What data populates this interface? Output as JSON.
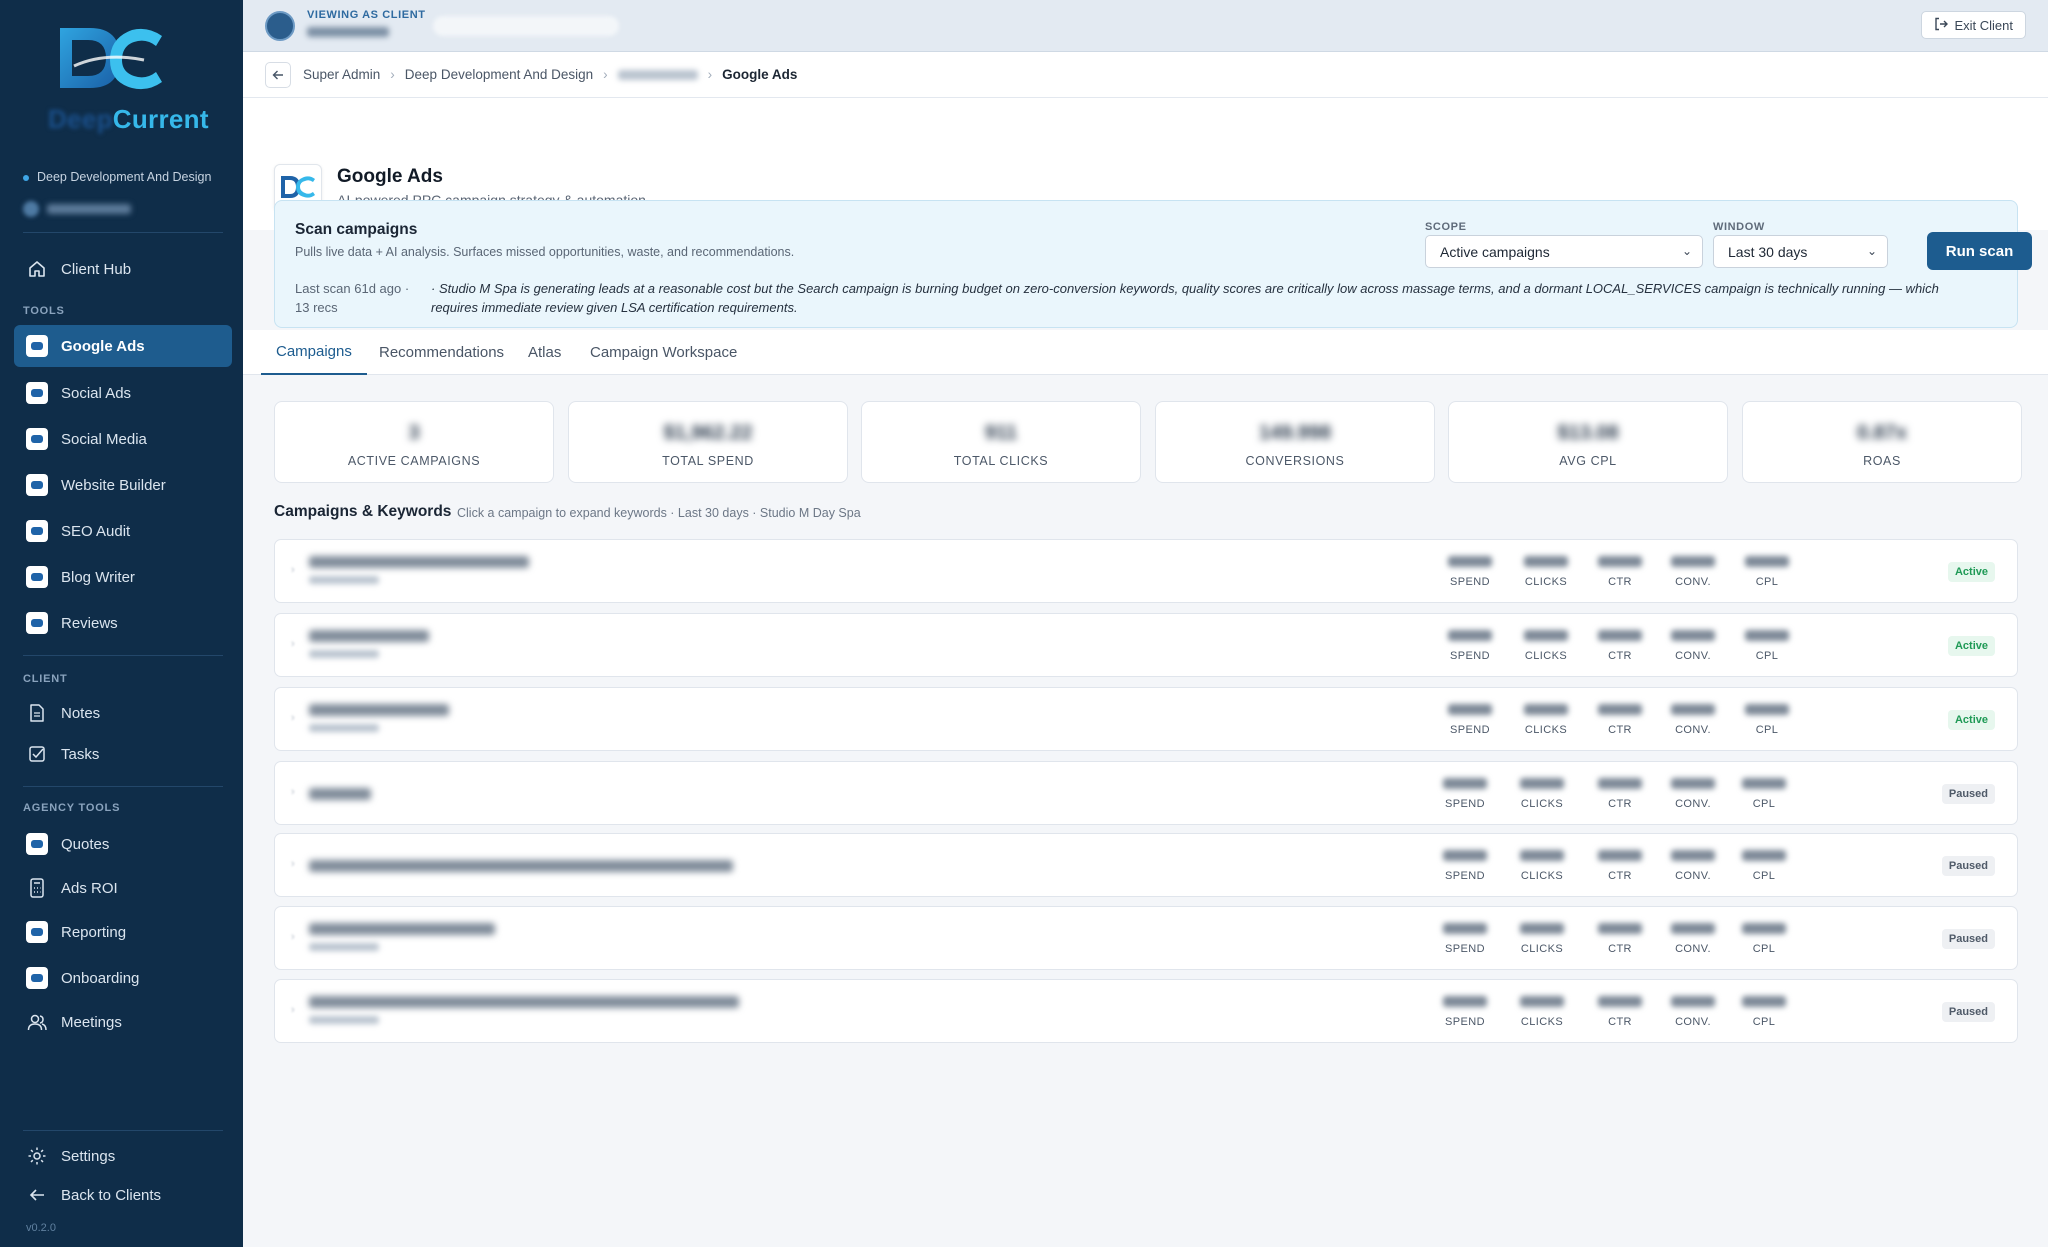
{
  "brand": {
    "name_part1": "Deep",
    "name_part2": "Current"
  },
  "sidebar": {
    "client_context": "Deep Development And Design",
    "sections": {
      "tools": "TOOLS",
      "client": "CLIENT",
      "agency": "AGENCY TOOLS"
    },
    "hub": "Client Hub",
    "tools": [
      "Google Ads",
      "Social Ads",
      "Social Media",
      "Website Builder",
      "SEO Audit",
      "Blog Writer",
      "Reviews"
    ],
    "client_items": [
      "Notes",
      "Tasks"
    ],
    "agency_items": [
      "Quotes",
      "Ads ROI",
      "Reporting",
      "Onboarding",
      "Meetings"
    ],
    "settings": "Settings",
    "back": "Back to Clients",
    "version": "v0.2.0"
  },
  "topbar": {
    "label": "VIEWING AS CLIENT",
    "exit": "Exit Client"
  },
  "breadcrumb": {
    "items": [
      "Super Admin",
      "Deep Development And Design"
    ],
    "current": "Google Ads"
  },
  "header": {
    "title": "Google Ads",
    "subtitle": "AI-powered PPC campaign strategy & automation"
  },
  "scan": {
    "title": "Scan campaigns",
    "desc": "Pulls live data + AI analysis. Surfaces missed opportunities, waste, and recommendations.",
    "last": "Last scan 61d ago · 13 recs",
    "summary": "· Studio M Spa is generating leads at a reasonable cost but the Search campaign is burning budget on zero-conversion keywords, quality scores are critically low across massage terms, and a dormant LOCAL_SERVICES campaign is technically running — which requires immediate review given LSA certification requirements.",
    "scope_label": "SCOPE",
    "scope_value": "Active campaigns",
    "window_label": "WINDOW",
    "window_value": "Last 30 days",
    "run": "Run scan"
  },
  "tabs": [
    "Campaigns",
    "Recommendations",
    "Atlas",
    "Campaign Workspace"
  ],
  "kpis": [
    {
      "value": "3",
      "label": "ACTIVE CAMPAIGNS"
    },
    {
      "value": "$1,962.22",
      "label": "TOTAL SPEND"
    },
    {
      "value": "911",
      "label": "TOTAL CLICKS"
    },
    {
      "value": "149.998",
      "label": "CONVERSIONS"
    },
    {
      "value": "$13.08",
      "label": "AVG CPL"
    },
    {
      "value": "0.87x",
      "label": "ROAS"
    }
  ],
  "campaigns_section": {
    "title": "Campaigns & Keywords",
    "hint": "Click a campaign to expand keywords · Last 30 days · Studio M Day Spa"
  },
  "metric_labels": [
    "SPEND",
    "CLICKS",
    "CTR",
    "CONV.",
    "CPL"
  ],
  "campaigns": [
    {
      "status": "Active"
    },
    {
      "status": "Active"
    },
    {
      "status": "Active"
    },
    {
      "status": "Paused"
    },
    {
      "status": "Paused"
    },
    {
      "status": "Paused"
    },
    {
      "status": "Paused"
    }
  ]
}
